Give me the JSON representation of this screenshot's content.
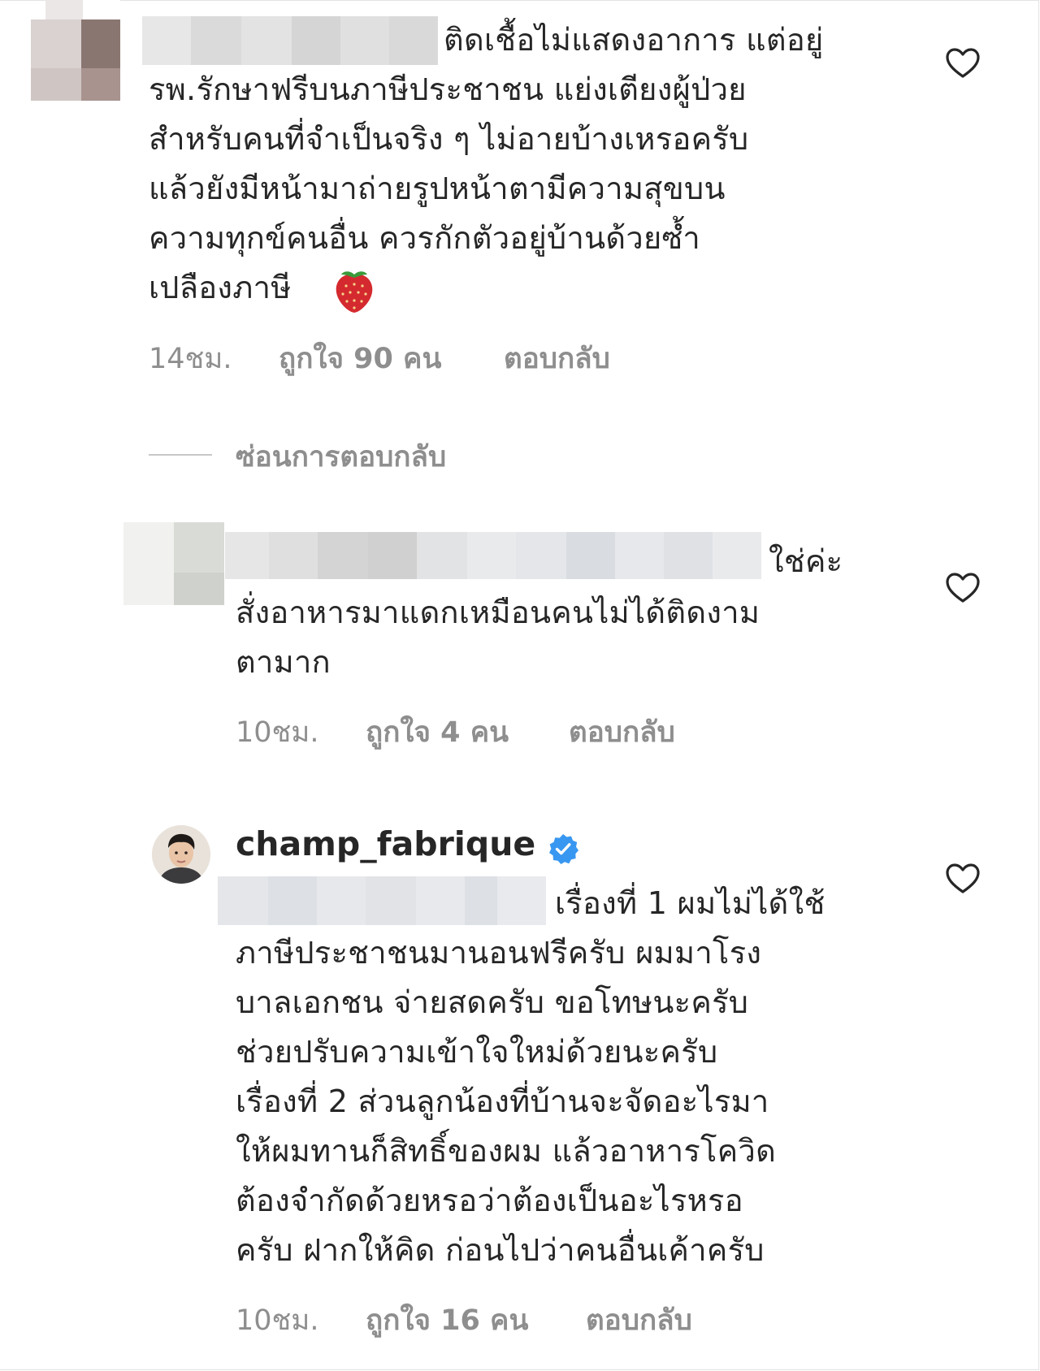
{
  "comments": [
    {
      "text_lines": [
        "ติดเชื้อไม่แสดงอาการ แต่อยู่",
        "รพ.รักษาฟรีบนภาษีประชาชน แย่งเตียงผู้ป่วย",
        "สำหรับคนที่จำเป็นจริง ๆ ไม่อายบ้างเหรอครับ",
        "แล้วยังมีหน้ามาถ่ายรูปหน้าตามีความสุขบน",
        "ความทุกข์คนอื่น ควรกักตัวอยู่บ้านด้วยซ้ำ",
        "เปลืองภาษี"
      ],
      "emoji": "strawberry",
      "time": "14ชม.",
      "likes": "ถูกใจ 90 คน",
      "reply": "ตอบกลับ"
    },
    {
      "text_lines": [
        "ใช่ค่ะ",
        "สั่งอาหารมาแดกเหมือนคนไม่ได้ติดงาม",
        "ตามาก"
      ],
      "time": "10ชม.",
      "likes": "ถูกใจ 4 คน",
      "reply": "ตอบกลับ"
    },
    {
      "username": "champ_fabrique",
      "verified": true,
      "text_lines": [
        "เรื่องที่ 1 ผมไม่ได้ใช้",
        "ภาษีประชาชนมานอนฟรีครับ ผมมาโรง",
        "บาลเอกชน จ่ายสดครับ ขอโทษนะครับ",
        "ช่วยปรับความเข้าใจใหม่ด้วยนะครับ",
        "เรื่องที่ 2 ส่วนลูกน้องที่บ้านจะจัดอะไรมา",
        "ให้ผมทานก็สิทธิ์ของผม แล้วอาหารโควิด",
        "ต้องจำกัดด้วยหรอว่าต้องเป็นอะไรหรอ",
        "ครับ ฝากให้คิด ก่อนไปว่าคนอื่นเค้าครับ"
      ],
      "time": "10ชม.",
      "likes": "ถูกใจ 16 คน",
      "reply": "ตอบกลับ"
    }
  ],
  "hide_replies": "ซ่อนการตอบกลับ",
  "icons": {
    "like": "heart-outline-icon",
    "verified": "verified-badge-icon",
    "emoji": "strawberry-emoji"
  },
  "colors": {
    "text": "#262626",
    "meta": "#8e8e8e",
    "verified": "#3897f0"
  }
}
